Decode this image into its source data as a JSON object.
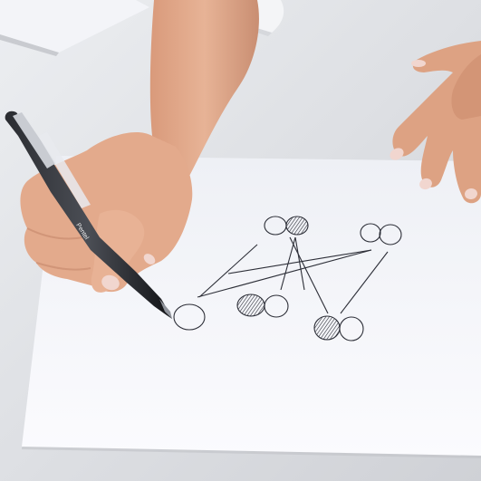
{
  "scene": {
    "table_color": "#dfe0e4",
    "paper_color": "#f7f7fb",
    "back_paper_color": "#f3f4f8",
    "skin_color": "#e0a98a",
    "skin_shadow": "#c98e72",
    "nail_color": "#f1d6cf",
    "sleeve_color": "#f4f5f7",
    "ink_color": "#2d2f38",
    "pen_body_color": "#1b1c20",
    "pen_trim_color": "#c9ccd2",
    "pen_brand_text": "Pentel",
    "icons": [
      "hand-icon",
      "pen-icon",
      "paper-sheet-icon",
      "network-sketch-icon"
    ]
  },
  "sketch": {
    "open_nodes": 6,
    "hatched_nodes": 3,
    "connecting_lines": 7
  }
}
